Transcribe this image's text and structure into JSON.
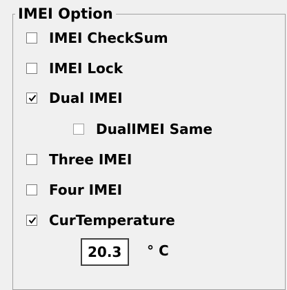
{
  "group": {
    "title": "IMEI Option"
  },
  "options": {
    "imei_checksum": {
      "label": "IMEI CheckSum",
      "checked": false
    },
    "imei_lock": {
      "label": "IMEI Lock",
      "checked": false
    },
    "dual_imei": {
      "label": "Dual IMEI",
      "checked": true
    },
    "dual_imei_same": {
      "label": "DualIMEI Same",
      "checked": false
    },
    "three_imei": {
      "label": "Three IMEI",
      "checked": false
    },
    "four_imei": {
      "label": "Four IMEI",
      "checked": false
    },
    "cur_temperature": {
      "label": "CurTemperature",
      "checked": true
    }
  },
  "temperature": {
    "value": "20.3",
    "unit": "° C"
  }
}
